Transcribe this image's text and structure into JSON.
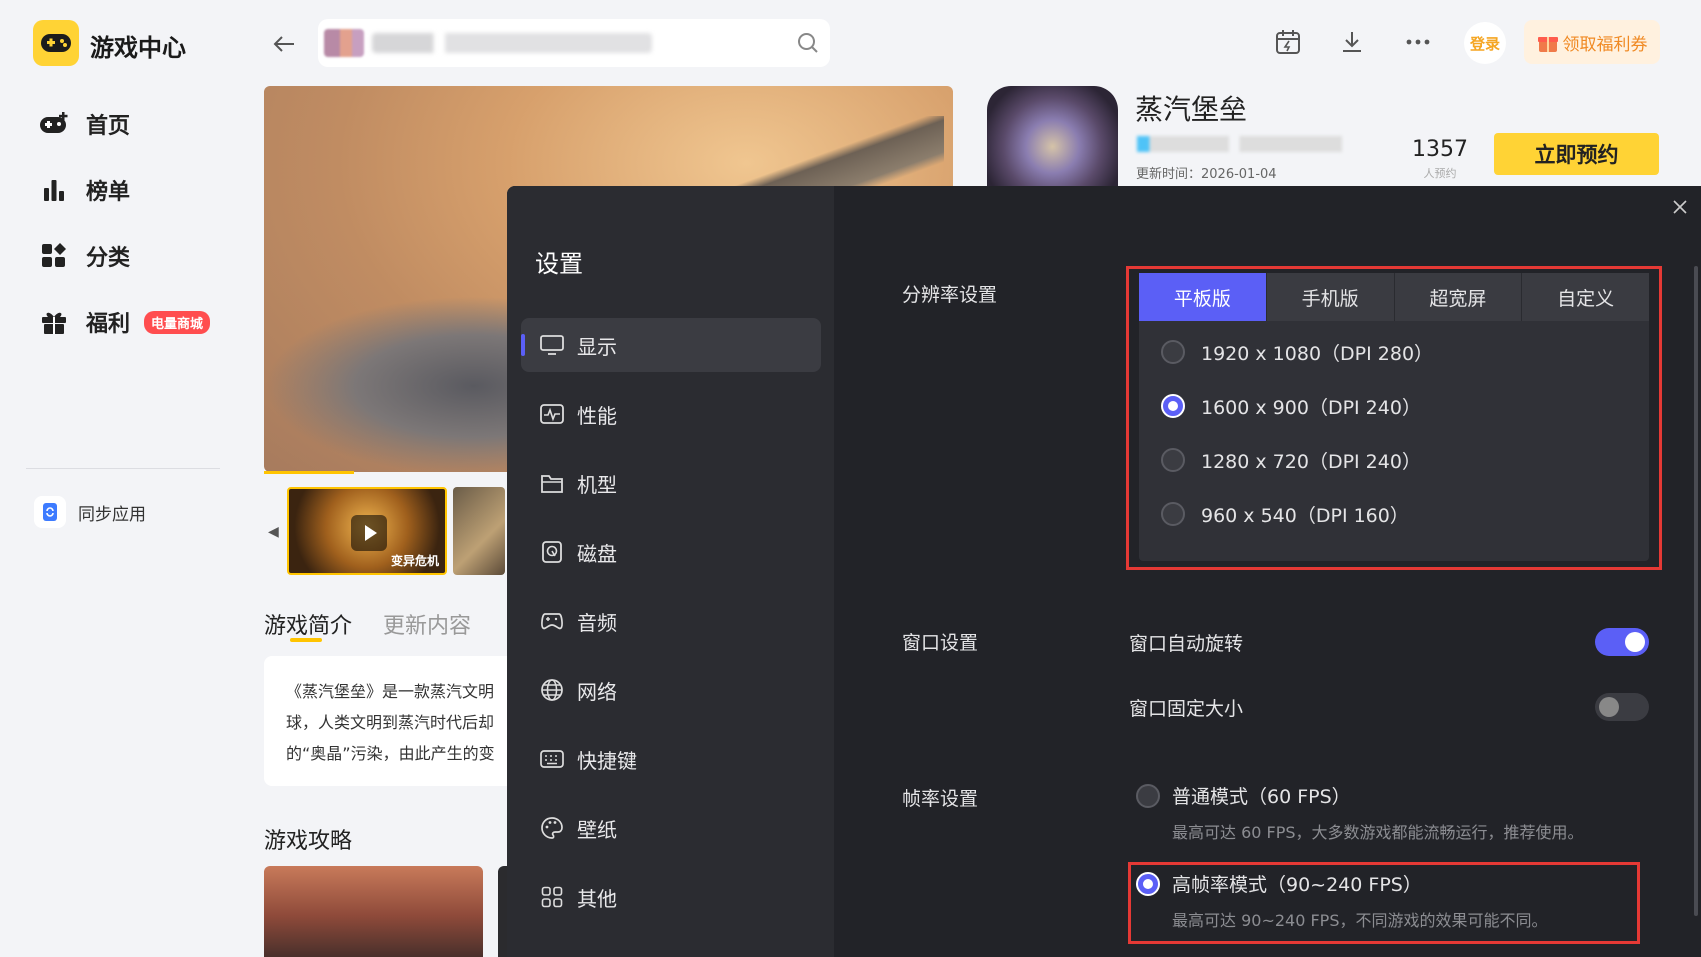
{
  "app": {
    "title": "游戏中心"
  },
  "sidebar": {
    "items": [
      {
        "label": "首页",
        "icon": "gamepad-plus-icon"
      },
      {
        "label": "榜单",
        "icon": "bar-chart-icon"
      },
      {
        "label": "分类",
        "icon": "category-icon"
      },
      {
        "label": "福利",
        "icon": "gift-icon",
        "badge": "电量商城"
      }
    ],
    "sync_label": "同步应用"
  },
  "topbar": {
    "login_label": "登录",
    "coupon_label": "领取福利券"
  },
  "game": {
    "name": "蒸汽堡垒",
    "update_time": "更新时间：2026-01-04",
    "reserve_count": "1357",
    "reserve_label": "人预约",
    "reserve_button": "立即预约",
    "tabs": [
      "游戏简介",
      "更新内容"
    ],
    "intro_lines": [
      "《蒸汽堡垒》是一款蒸汽文明",
      "球，人类文明到蒸汽时代后却",
      "的“奥晶”污染，由此产生的变"
    ],
    "guide_title": "游戏攻略",
    "thumb_caption": "变异危机"
  },
  "settings": {
    "title": "设置",
    "menu": [
      {
        "label": "显示",
        "icon": "monitor-icon",
        "active": true
      },
      {
        "label": "性能",
        "icon": "performance-icon"
      },
      {
        "label": "机型",
        "icon": "folder-icon"
      },
      {
        "label": "磁盘",
        "icon": "disk-icon"
      },
      {
        "label": "音频",
        "icon": "gamepad-icon"
      },
      {
        "label": "网络",
        "icon": "globe-icon"
      },
      {
        "label": "快捷键",
        "icon": "keyboard-icon"
      },
      {
        "label": "壁纸",
        "icon": "palette-icon"
      },
      {
        "label": "其他",
        "icon": "grid-icon"
      }
    ],
    "resolution": {
      "label": "分辨率设置",
      "tabs": [
        "平板版",
        "手机版",
        "超宽屏",
        "自定义"
      ],
      "active_tab": "平板版",
      "options": [
        "1920 x 1080（DPI 280）",
        "1600 x 900（DPI 240）",
        "1280 x 720（DPI 240）",
        "960 x 540（DPI 160）"
      ],
      "selected": "1600 x 900（DPI 240）"
    },
    "window": {
      "label": "窗口设置",
      "auto_rotate": {
        "label": "窗口自动旋转",
        "on": true
      },
      "fixed_size": {
        "label": "窗口固定大小",
        "on": false
      }
    },
    "fps": {
      "label": "帧率设置",
      "normal": {
        "title": "普通模式（60 FPS）",
        "desc": "最高可达 60 FPS，大多数游戏都能流畅运行，推荐使用。"
      },
      "high": {
        "title": "高帧率模式（90~240 FPS）",
        "desc": "最高可达 90~240 FPS，不同游戏的效果可能不同。"
      },
      "selected": "high"
    }
  },
  "colors": {
    "accent": "#5b5ff6",
    "brand_yellow": "#ffd335",
    "highlight_red": "#e53935"
  }
}
